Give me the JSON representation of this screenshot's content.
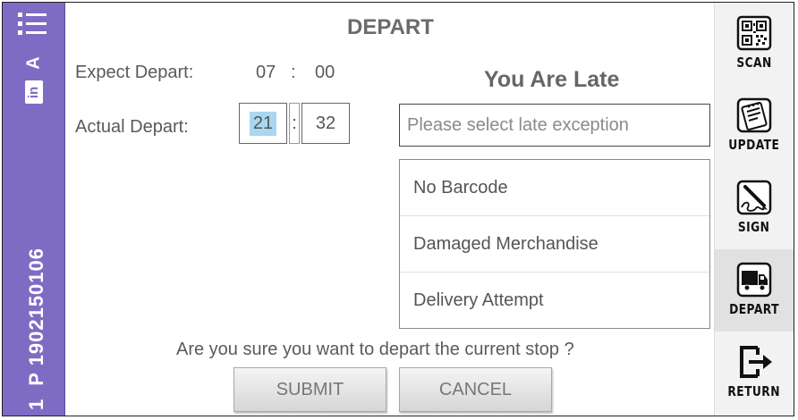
{
  "sidebar": {
    "menu_icon": "list-menu-icon",
    "letter": "A",
    "badge": "in",
    "route_code": "P 1902150106",
    "stop_number": "1"
  },
  "header": {
    "title": "DEPART"
  },
  "form": {
    "expect_label": "Expect Depart:",
    "expect_hour": "07",
    "expect_sep": ":",
    "expect_minute": "00",
    "actual_label": "Actual Depart:",
    "actual_hour": "21",
    "actual_sep": ":",
    "actual_minute": "32",
    "late_title": "You Are Late",
    "exception_placeholder": "Please select late exception",
    "exception_options": [
      "No Barcode",
      "Damaged Merchandise",
      "Delivery Attempt"
    ],
    "confirm_text": "Are you sure you want to depart the current stop ?",
    "submit_label": "SUBMIT",
    "cancel_label": "CANCEL"
  },
  "actions": [
    {
      "label": "SCAN",
      "icon": "qr-code-icon"
    },
    {
      "label": "UPDATE",
      "icon": "clipboard-edit-icon"
    },
    {
      "label": "SIGN",
      "icon": "pen-sign-icon"
    },
    {
      "label": "DEPART",
      "icon": "truck-icon",
      "active": true
    },
    {
      "label": "RETURN",
      "icon": "exit-arrow-icon"
    }
  ]
}
